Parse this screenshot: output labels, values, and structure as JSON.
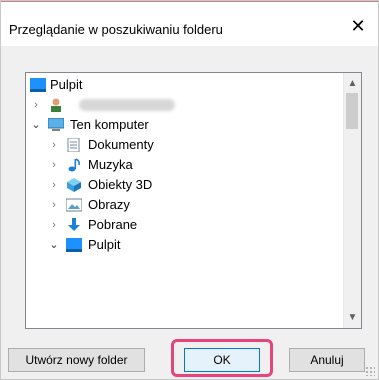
{
  "dialog": {
    "title": "Przeglądanie w poszukiwaniu folderu",
    "close_label": "✕"
  },
  "tree": {
    "items": [
      {
        "label": "Pulpit",
        "icon": "desktop-icon",
        "chevron": ""
      },
      {
        "label": "",
        "icon": "user-icon",
        "chevron": "›"
      },
      {
        "label": "Ten komputer",
        "icon": "computer-icon",
        "chevron": "⌄"
      },
      {
        "label": "Dokumenty",
        "icon": "documents-icon",
        "chevron": "›"
      },
      {
        "label": "Muzyka",
        "icon": "music-icon",
        "chevron": "›"
      },
      {
        "label": "Obiekty 3D",
        "icon": "objects-3d-icon",
        "chevron": "›"
      },
      {
        "label": "Obrazy",
        "icon": "pictures-icon",
        "chevron": "›"
      },
      {
        "label": "Pobrane",
        "icon": "download-icon",
        "chevron": "›"
      },
      {
        "label": "Pulpit",
        "icon": "desktop-icon",
        "chevron": "⌄"
      }
    ]
  },
  "buttons": {
    "new_folder": "Utwórz nowy folder",
    "ok": "OK",
    "cancel": "Anuluj"
  },
  "colors": {
    "highlight": "#e8447a",
    "desktop_blue": "#1e90ff"
  }
}
